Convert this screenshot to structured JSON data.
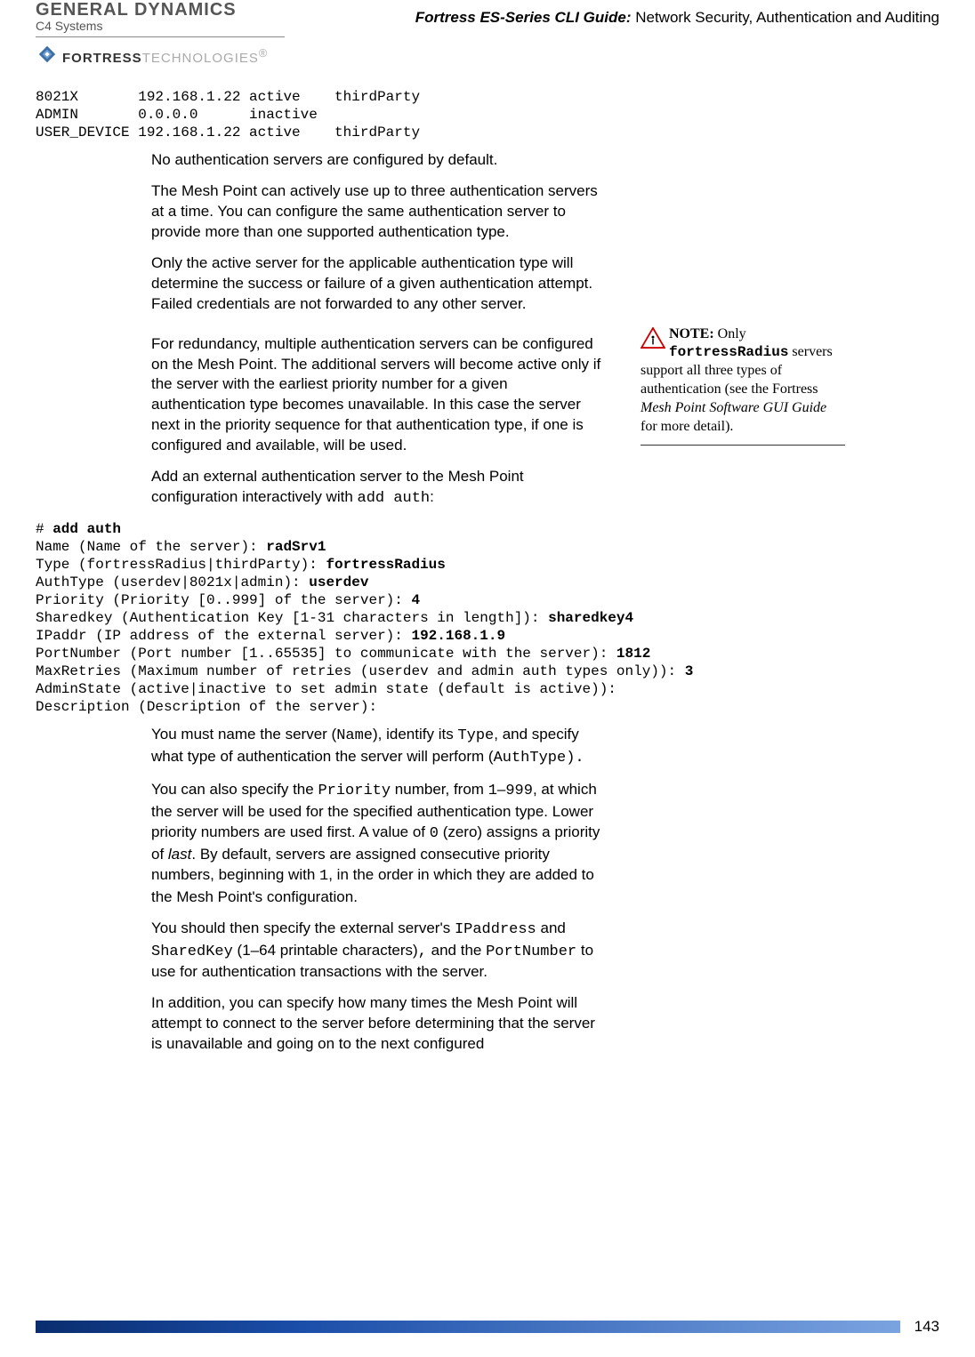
{
  "header": {
    "gd_line1": "GENERAL DYNAMICS",
    "gd_line2": "C4 Systems",
    "fortress": "FORTRESS",
    "technologies": "TECHNOLOGIES",
    "sup": "®",
    "title_em": "Fortress ES-Series CLI Guide:",
    "title_rest": " Network Security, Authentication and Auditing"
  },
  "code_block1_lines": [
    "8021X       192.168.1.22 active    thirdParty",
    "ADMIN       0.0.0.0      inactive",
    "USER_DEVICE 192.168.1.22 active    thirdParty"
  ],
  "para1": "No authentication servers are configured by default.",
  "para2": "The Mesh Point can actively use up to three authentication servers at a time. You can configure the same authentication server to provide more than one supported authentication type.",
  "para3": "Only the active server for the applicable authentication type will determine the success or failure of a given authentication attempt. Failed credentials are not forwarded to any other server.",
  "para4": "For redundancy, multiple authentication servers can be configured on the Mesh Point. The additional servers will become active only if the server with the earliest priority number for a given authentication type becomes unavailable. In this case the server next in the priority sequence for that authentication type, if one is configured and available, will be used.",
  "para5_pre": "Add an external authentication server to the Mesh Point configuration interactively with ",
  "para5_cmd": "add auth",
  "para5_post": ":",
  "note": {
    "title": "NOTE:",
    "t1": " Only ",
    "mono": "fortressRadius",
    "t2": " servers support all three types of authentication (see the Fortress ",
    "em": "Mesh Point Software GUI Guide",
    "t3": " for more detail)."
  },
  "cli": {
    "prompt": "# ",
    "cmd": "add auth",
    "l1a": "Name (Name of the server): ",
    "l1b": "radSrv1",
    "l2a": "Type (fortressRadius|thirdParty): ",
    "l2b": "fortressRadius",
    "l3a": "AuthType (userdev|8021x|admin): ",
    "l3b": "userdev",
    "l4a": "Priority (Priority [0..999] of the server): ",
    "l4b": "4",
    "l5a": "Sharedkey (Authentication Key [1-31 characters in length]): ",
    "l5b": "sharedkey4",
    "l6a": "IPaddr (IP address of the external server): ",
    "l6b": "192.168.1.9",
    "l7a": "PortNumber (Port number [1..65535] to communicate with the server): ",
    "l7b": "1812",
    "l8a": "MaxRetries (Maximum number of retries (userdev and admin auth types only)): ",
    "l8b": "3",
    "l9": "AdminState (active|inactive to set admin state (default is active)):",
    "l10": "Description (Description of the server):"
  },
  "para6": {
    "t1": "You must name the server (",
    "m1": "Name",
    "t2": "), identify its ",
    "m2": "Type",
    "t3": ", and specify what type of authentication the server will perform (",
    "m3": "AuthType).",
    "t4": ""
  },
  "para7": {
    "t1": "You can also specify the ",
    "m1": "Priority",
    "t2": " number, from ",
    "m2": "1",
    "t3": "–",
    "m3": "999",
    "t4": ", at which the server will be used for the specified authentication type. Lower priority numbers are used first. A value of ",
    "m4": "0",
    "t5": " (zero) assigns a priority of ",
    "em": "last",
    "t6": ". By default, servers are assigned consecutive priority numbers, beginning with ",
    "m5": "1",
    "t7": ", in the order in which they are added to the Mesh Point's configuration."
  },
  "para8": {
    "t1": "You should then specify the external server's ",
    "m1": "IPaddress",
    "t2": " and ",
    "m2": "SharedKey",
    "t3": " (1–64 printable characters)",
    "m3": ",",
    "t4": " and the ",
    "m4": "PortNumber",
    "t5": " to use for authentication transactions with the server."
  },
  "para9": "In addition, you can specify how many times the Mesh Point will attempt to connect to the server before determining that the server is unavailable and going on to the next configured",
  "page_number": "143"
}
